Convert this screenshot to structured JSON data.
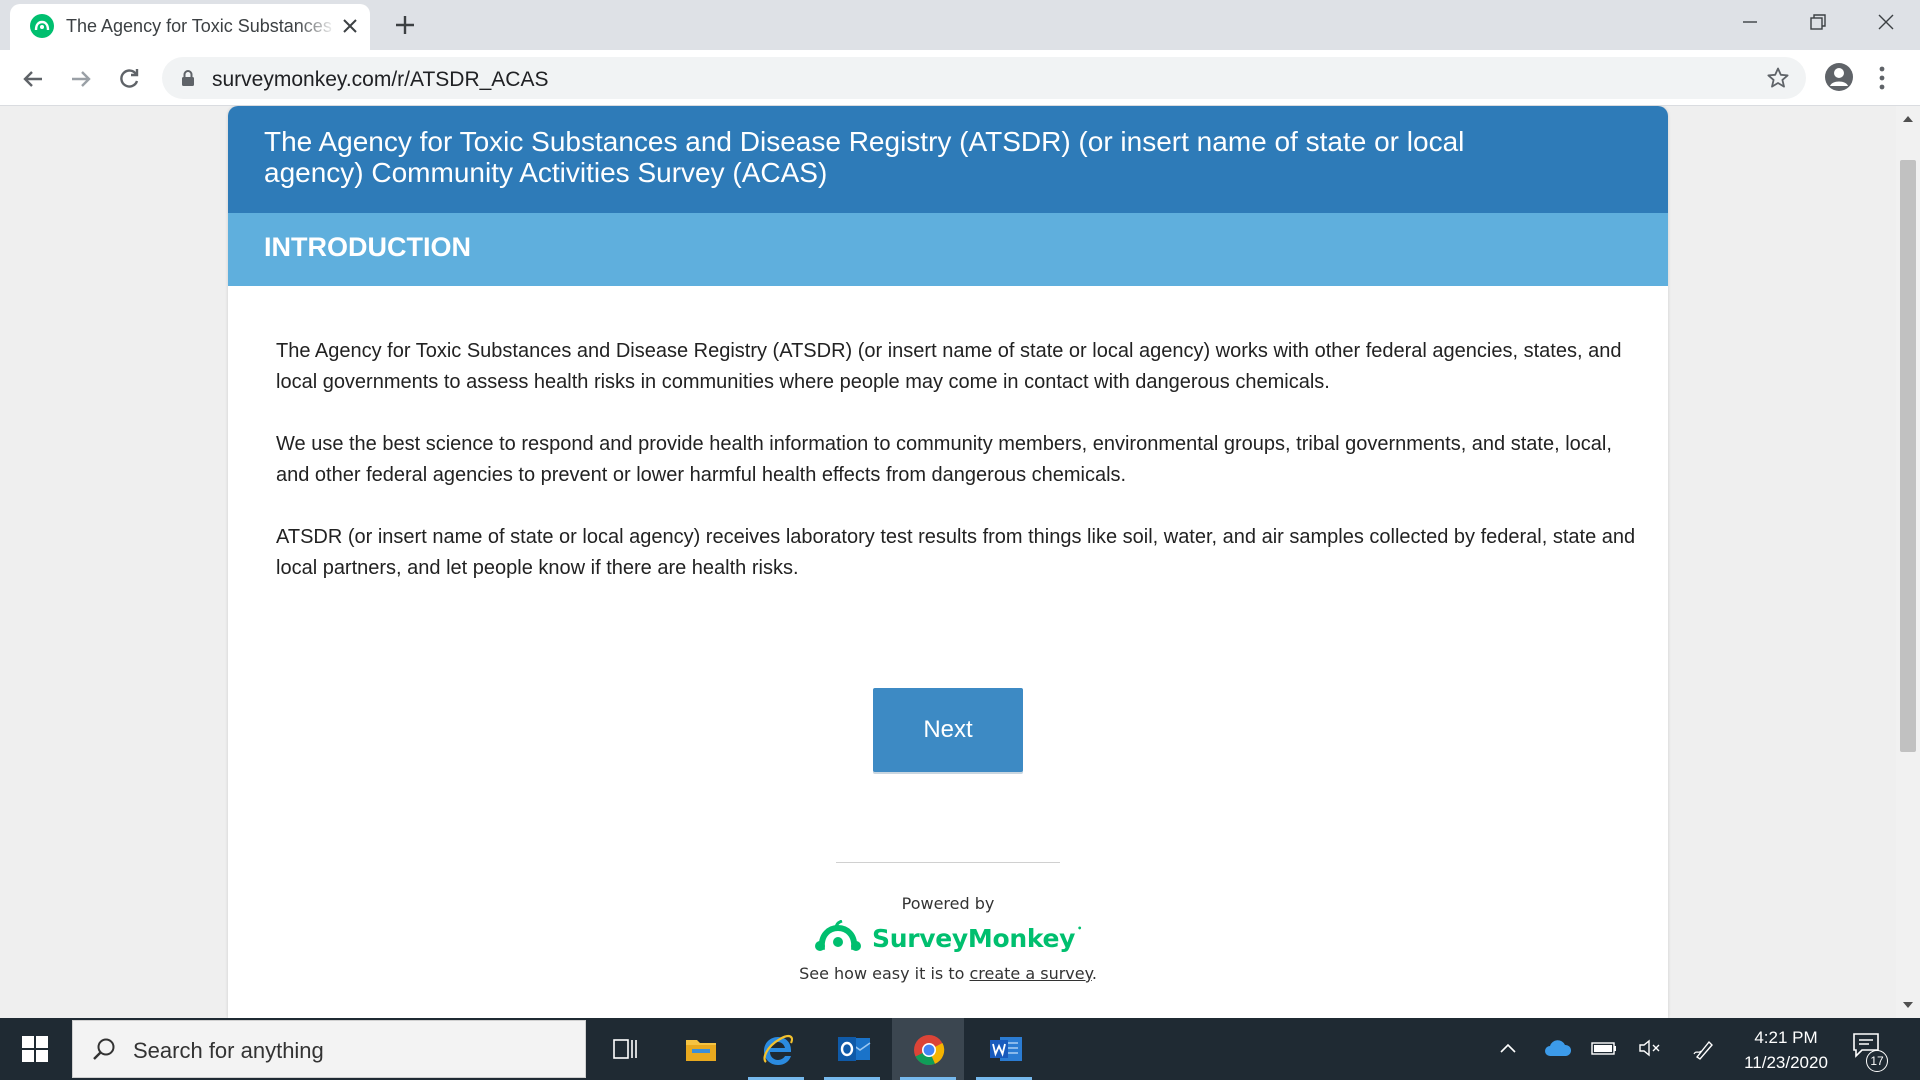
{
  "browser": {
    "tab_title": "The Agency for Toxic Substances and Disease Registry (ATSDR) Community Activities Survey",
    "url": "surveymonkey.com/r/ATSDR_ACAS"
  },
  "survey": {
    "title": "The Agency for Toxic Substances and Disease Registry (ATSDR) (or insert name of state or local agency) Community Activities Survey (ACAS)",
    "page_title": "INTRODUCTION",
    "paragraphs": [
      "The Agency for Toxic Substances and Disease Registry (ATSDR) (or insert name of state or local agency) works with other federal agencies, states, and local governments to assess health risks in communities where people may come in contact with dangerous chemicals.",
      "We use the best science to respond and provide health information to community members, environmental groups, tribal governments, and state, local, and other federal agencies to prevent or lower harmful health effects from dangerous chemicals.",
      "ATSDR (or insert name of state or local agency) receives laboratory test results from things like soil, water, and air samples collected by federal, state and local partners, and let people know if there are health risks."
    ],
    "next_label": "Next"
  },
  "footer": {
    "powered_by": "Powered by",
    "brand": "SurveyMonkey",
    "see_how_prefix": "See how easy it is to ",
    "see_how_link": "create a survey",
    "see_how_suffix": "."
  },
  "taskbar": {
    "search_placeholder": "Search for anything",
    "time": "4:21 PM",
    "date": "11/23/2020",
    "notification_count": "17"
  },
  "colors": {
    "header_blue": "#2e7bb8",
    "page_bar_blue": "#5fafdd",
    "button_blue": "#3d8ac4",
    "brand_green": "#00bf6f"
  }
}
